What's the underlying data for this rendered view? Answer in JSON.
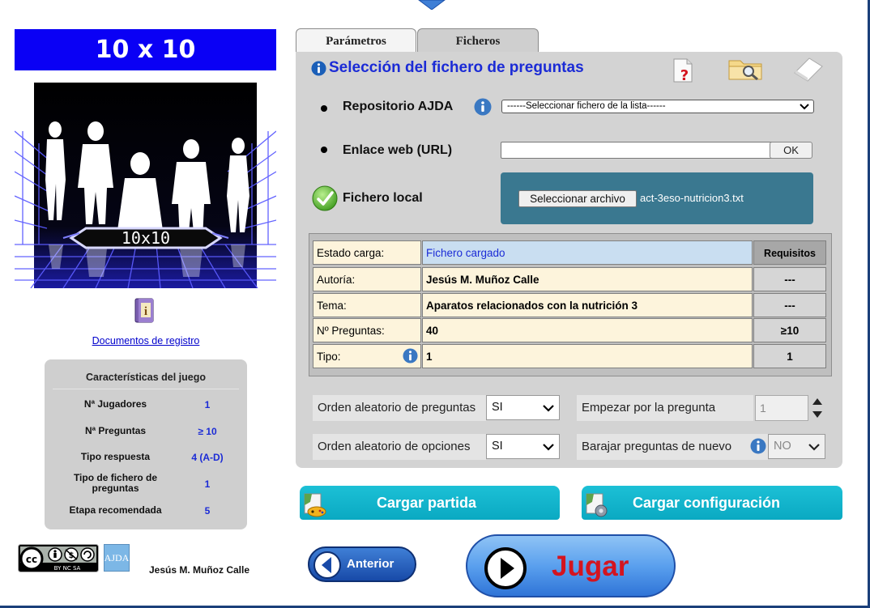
{
  "game": {
    "title": "10 x 10",
    "banner_text": "10x10",
    "docs_link": "Documentos de registro"
  },
  "features": {
    "title": "Características del juego",
    "rows": [
      {
        "label": "Nª Jugadores",
        "value": "1"
      },
      {
        "label": "Nª Preguntas",
        "value": "≥ 10"
      },
      {
        "label": "Tipo respuesta",
        "value": "4 (A-D)"
      },
      {
        "label": "Tipo de fichero de preguntas",
        "value": "1"
      },
      {
        "label": "Etapa recomendada",
        "value": "5"
      }
    ]
  },
  "footer": {
    "license_text": "BY NC SA",
    "logo_text": "AJDA",
    "author": "Jesús M. Muñoz Calle"
  },
  "tabs": [
    {
      "label": "Parámetros",
      "active": false
    },
    {
      "label": "Ficheros",
      "active": true
    }
  ],
  "files": {
    "section_title": "Selección del fichero de preguntas",
    "repo_label": "Repositorio AJDA",
    "repo_select_value": "------Seleccionar fichero de la lista------",
    "url_label": "Enlace web (URL)",
    "url_value": "",
    "ok_label": "OK",
    "local_label": "Fichero local",
    "choose_file_label": "Seleccionar archivo",
    "file_name": "act-3eso-nutricion3.txt"
  },
  "status_table": {
    "req_header": "Requisitos",
    "rows": [
      {
        "label": "Estado carga:",
        "value": "Fichero cargado",
        "req": ""
      },
      {
        "label": "Autoría:",
        "value": "Jesús M. Muñoz Calle",
        "req": "---"
      },
      {
        "label": "Tema:",
        "value": "Aparatos relacionados con la nutrición 3",
        "req": "---"
      },
      {
        "label": "Nº Preguntas:",
        "value": "40",
        "req": "≥10"
      },
      {
        "label": "Tipo:",
        "value": "1",
        "req": "1"
      }
    ]
  },
  "options": {
    "random_questions_label": "Orden aleatorio de preguntas",
    "random_questions_value": "SI",
    "random_options_label": "Orden aleatorio de opciones",
    "random_options_value": "SI",
    "start_question_label": "Empezar por la pregunta",
    "start_question_value": "1",
    "reshuffle_label": "Barajar preguntas de nuevo",
    "reshuffle_value": "NO"
  },
  "actions": {
    "load_game": "Cargar partida",
    "load_config": "Cargar configuración",
    "previous": "Anterior",
    "play": "Jugar"
  },
  "colors": {
    "title_blue": "#0a00f5",
    "accent_blue": "#1b2bd6",
    "panel_gray": "#d3d3d3",
    "local_box": "#3a7890",
    "action_cyan": "#0aa9c2",
    "play_red": "#d4141f"
  }
}
